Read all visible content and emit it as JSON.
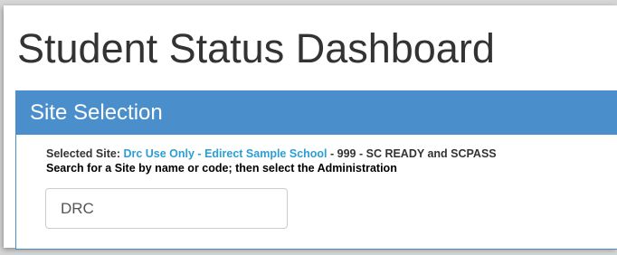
{
  "page": {
    "title": "Student Status Dashboard"
  },
  "site_selection": {
    "heading": "Site Selection",
    "selected_label": "Selected Site: ",
    "selected_site_name": "Drc Use Only - Edirect Sample School",
    "selected_site_suffix": " - 999 - SC READY and SCPASS",
    "search_hint": "Search for a Site by name or code; then select the Administration",
    "search_value": "DRC"
  },
  "colors": {
    "panel_heading_bg": "#4a8fcc",
    "site_link": "#2a9fd6"
  }
}
